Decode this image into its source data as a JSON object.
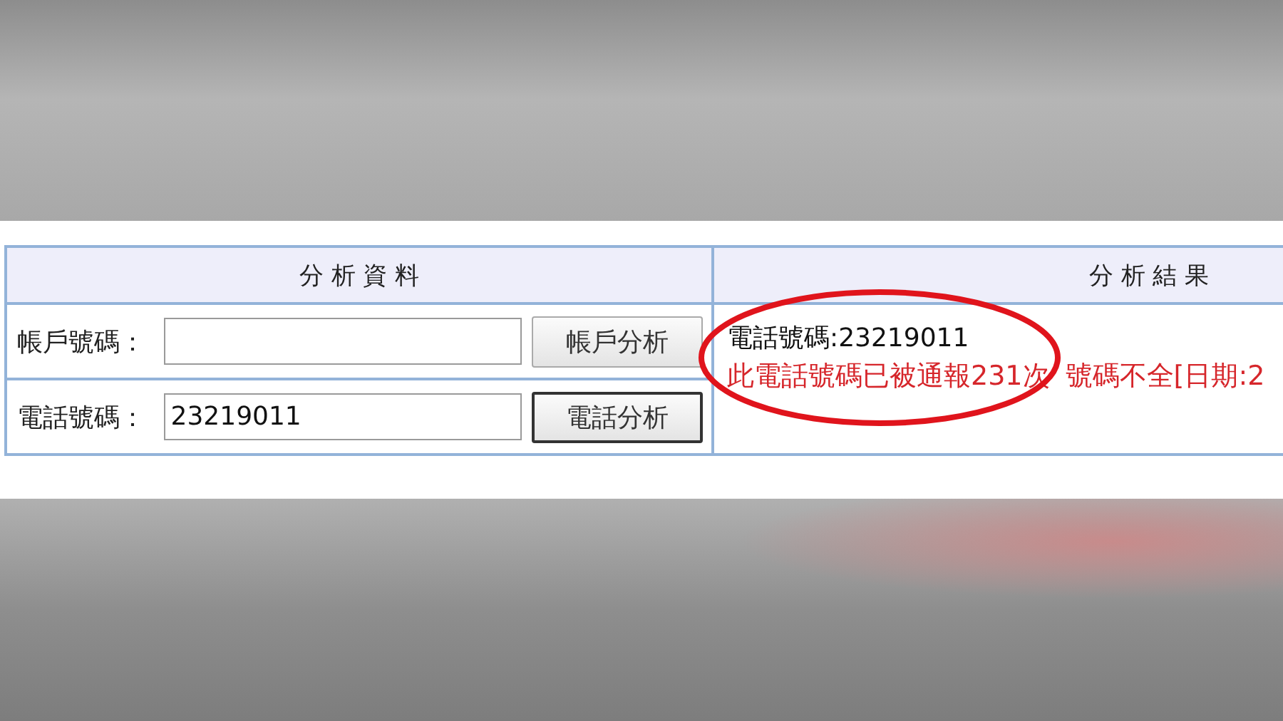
{
  "left_panel": {
    "title": "分 析 資 料",
    "rows": [
      {
        "label": "帳戶號碼：",
        "button": "帳戶分析",
        "focused": false
      },
      {
        "label": "電話號碼：",
        "value": "23219011",
        "button": "電話分析",
        "focused": true
      }
    ]
  },
  "right_panel": {
    "title": "分 析 結 果",
    "result_lines": [
      {
        "kind": "info",
        "text": "電話號碼:23219011"
      },
      {
        "kind": "warning",
        "text": "此電話號碼已被通報231次 號碼不全[日期:2"
      }
    ]
  }
}
